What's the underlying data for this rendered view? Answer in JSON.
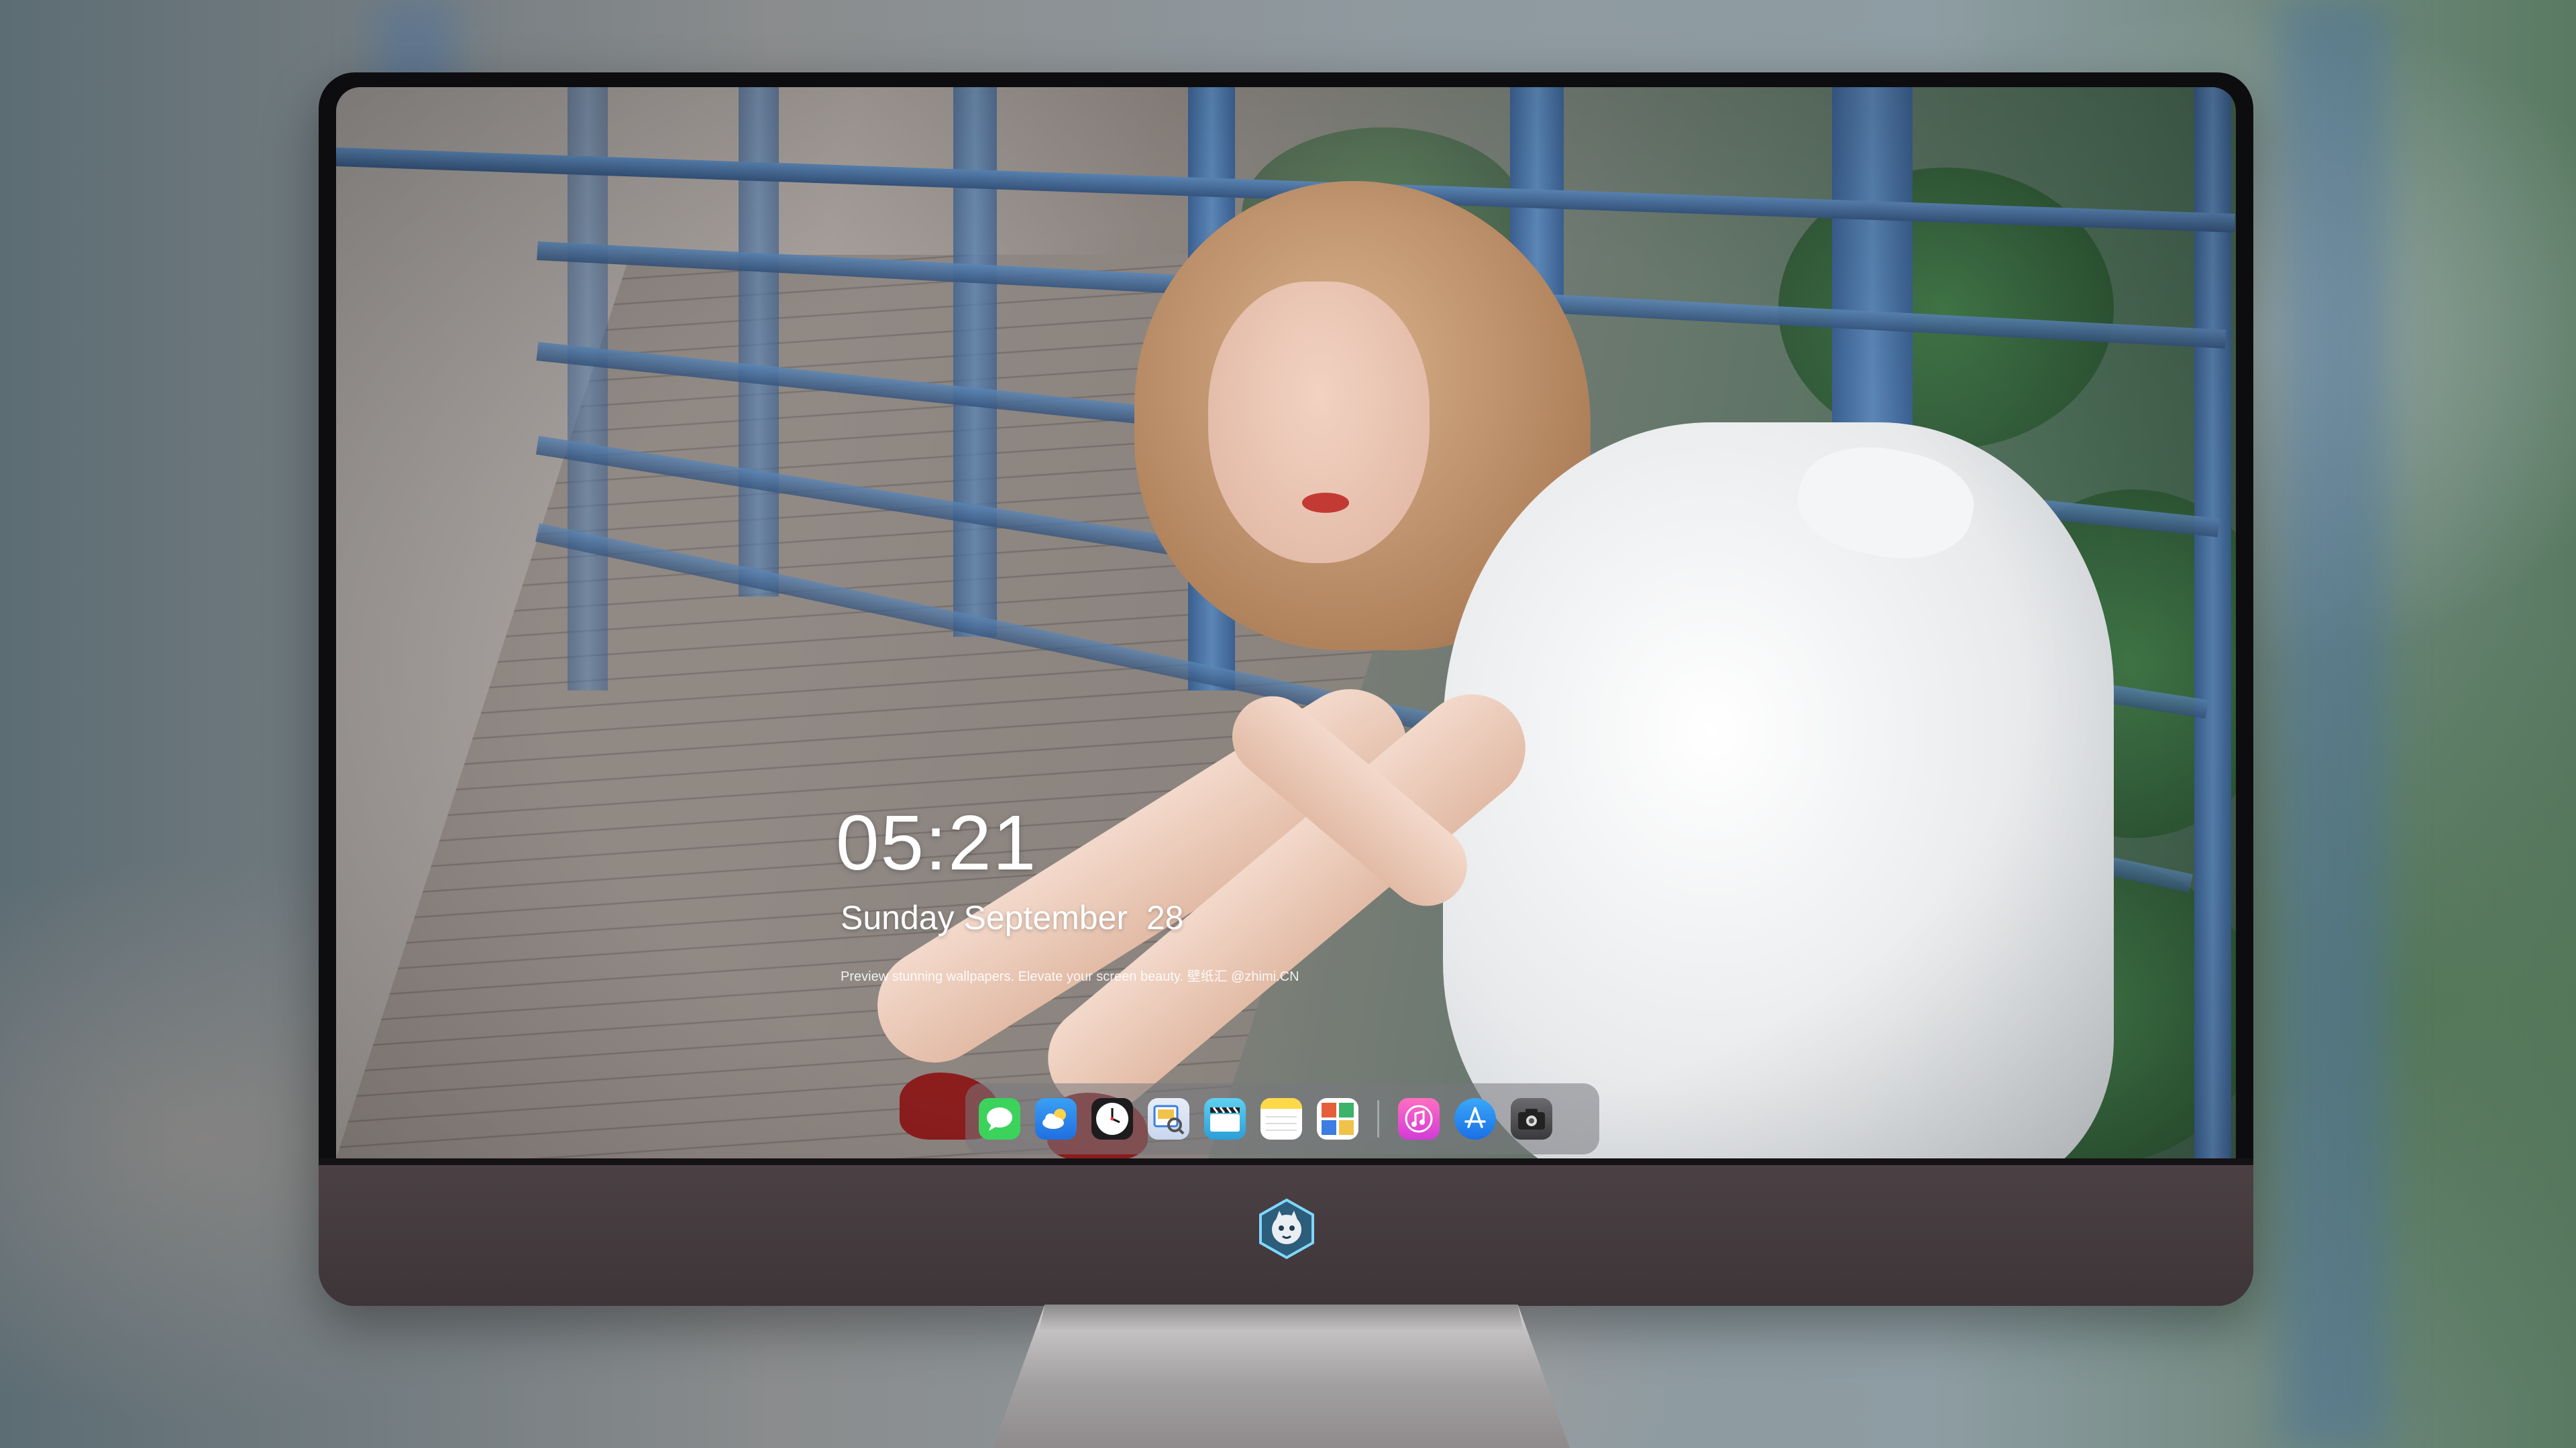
{
  "lock_screen": {
    "time": "05:21",
    "date": "Sunday September  28",
    "tagline": "Preview stunning wallpapers. Elevate your screen beauty. 壁纸汇 @zhimi.CN"
  },
  "dock": {
    "apps": [
      {
        "name": "messages-icon",
        "color": "#3bd35b"
      },
      {
        "name": "weather-icon",
        "color": "#2f8ff0"
      },
      {
        "name": "clock-icon",
        "color": "#1c1c1e"
      },
      {
        "name": "preview-icon",
        "color": "#f0c24a"
      },
      {
        "name": "clips-icon",
        "color": "#33b6e6"
      },
      {
        "name": "notes-icon",
        "color": "#ffd84a"
      },
      {
        "name": "photo-booth-icon",
        "color": "#e55d3b"
      },
      {
        "name": "music-icon",
        "color": "#ff4fa8"
      },
      {
        "name": "app-store-icon",
        "color": "#1f8ef5"
      },
      {
        "name": "camera-icon",
        "color": "#3a3a3c"
      }
    ]
  },
  "colors": {
    "bezel": "#0d0d0f",
    "chin": "#4b4144",
    "stand": "#a3a0a1",
    "rail_blue": "#4f7bb0"
  }
}
